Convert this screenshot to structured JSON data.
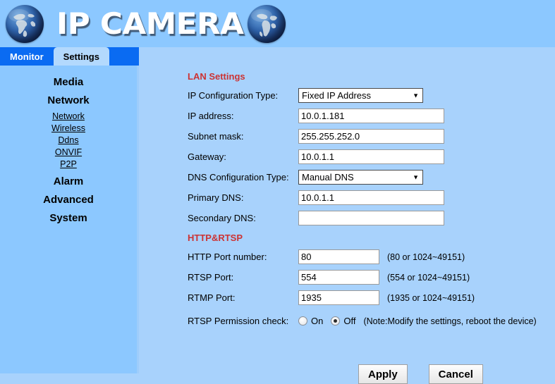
{
  "header": {
    "title": "IP CAMERA",
    "left_globe_icon": "globe-icon",
    "right_globe_icon": "globe-icon"
  },
  "tabs": [
    {
      "label": "Monitor",
      "active": false
    },
    {
      "label": "Settings",
      "active": true
    }
  ],
  "sidebar": {
    "items": [
      {
        "label": "Media",
        "type": "group"
      },
      {
        "label": "Network",
        "type": "group"
      },
      {
        "label": "Network",
        "type": "link"
      },
      {
        "label": "Wireless",
        "type": "link"
      },
      {
        "label": "Ddns",
        "type": "link"
      },
      {
        "label": "ONVIF",
        "type": "link"
      },
      {
        "label": "P2P",
        "type": "link"
      },
      {
        "label": "Alarm",
        "type": "group"
      },
      {
        "label": "Advanced",
        "type": "group"
      },
      {
        "label": "System",
        "type": "group"
      }
    ]
  },
  "lan": {
    "section_title": "LAN Settings",
    "ip_config_type": {
      "label": "IP Configuration Type:",
      "value": "Fixed IP Address"
    },
    "ip_address": {
      "label": "IP address:",
      "value": "10.0.1.181"
    },
    "subnet_mask": {
      "label": "Subnet mask:",
      "value": "255.255.252.0"
    },
    "gateway": {
      "label": "Gateway:",
      "value": "10.0.1.1"
    },
    "dns_config_type": {
      "label": "DNS Configuration Type:",
      "value": "Manual DNS"
    },
    "primary_dns": {
      "label": "Primary DNS:",
      "value": "10.0.1.1"
    },
    "secondary_dns": {
      "label": "Secondary DNS:",
      "value": ""
    }
  },
  "http_rtsp": {
    "section_title": "HTTP&RTSP",
    "http_port": {
      "label": "HTTP Port number:",
      "value": "80",
      "hint": "(80 or 1024~49151)"
    },
    "rtsp_port": {
      "label": "RTSP Port:",
      "value": "554",
      "hint": "(554 or 1024~49151)"
    },
    "rtmp_port": {
      "label": "RTMP Port:",
      "value": "1935",
      "hint": "(1935 or 1024~49151)"
    },
    "rtsp_permission": {
      "label": "RTSP Permission check:",
      "on_label": "On",
      "off_label": "Off",
      "selected": "Off",
      "note": "(Note:Modify the settings, reboot the device)"
    }
  },
  "buttons": {
    "apply": "Apply",
    "cancel": "Cancel"
  },
  "colors": {
    "header_bg": "#8cc8ff",
    "content_bg": "#a8d2fc",
    "tab_active_bg": "#b3d9fd",
    "tab_bar_bg": "#0a6bf2",
    "section_title": "#cc3333"
  }
}
